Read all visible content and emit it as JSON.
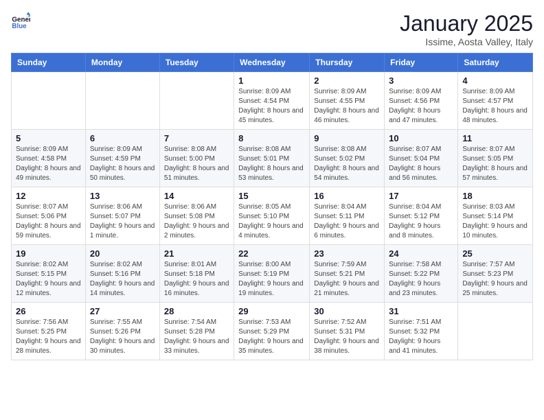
{
  "logo": {
    "line1": "General",
    "line2": "Blue"
  },
  "header": {
    "month": "January 2025",
    "location": "Issime, Aosta Valley, Italy"
  },
  "weekdays": [
    "Sunday",
    "Monday",
    "Tuesday",
    "Wednesday",
    "Thursday",
    "Friday",
    "Saturday"
  ],
  "weeks": [
    [
      {
        "day": "",
        "info": ""
      },
      {
        "day": "",
        "info": ""
      },
      {
        "day": "",
        "info": ""
      },
      {
        "day": "1",
        "info": "Sunrise: 8:09 AM\nSunset: 4:54 PM\nDaylight: 8 hours\nand 45 minutes."
      },
      {
        "day": "2",
        "info": "Sunrise: 8:09 AM\nSunset: 4:55 PM\nDaylight: 8 hours\nand 46 minutes."
      },
      {
        "day": "3",
        "info": "Sunrise: 8:09 AM\nSunset: 4:56 PM\nDaylight: 8 hours\nand 47 minutes."
      },
      {
        "day": "4",
        "info": "Sunrise: 8:09 AM\nSunset: 4:57 PM\nDaylight: 8 hours\nand 48 minutes."
      }
    ],
    [
      {
        "day": "5",
        "info": "Sunrise: 8:09 AM\nSunset: 4:58 PM\nDaylight: 8 hours\nand 49 minutes."
      },
      {
        "day": "6",
        "info": "Sunrise: 8:09 AM\nSunset: 4:59 PM\nDaylight: 8 hours\nand 50 minutes."
      },
      {
        "day": "7",
        "info": "Sunrise: 8:08 AM\nSunset: 5:00 PM\nDaylight: 8 hours\nand 51 minutes."
      },
      {
        "day": "8",
        "info": "Sunrise: 8:08 AM\nSunset: 5:01 PM\nDaylight: 8 hours\nand 53 minutes."
      },
      {
        "day": "9",
        "info": "Sunrise: 8:08 AM\nSunset: 5:02 PM\nDaylight: 8 hours\nand 54 minutes."
      },
      {
        "day": "10",
        "info": "Sunrise: 8:07 AM\nSunset: 5:04 PM\nDaylight: 8 hours\nand 56 minutes."
      },
      {
        "day": "11",
        "info": "Sunrise: 8:07 AM\nSunset: 5:05 PM\nDaylight: 8 hours\nand 57 minutes."
      }
    ],
    [
      {
        "day": "12",
        "info": "Sunrise: 8:07 AM\nSunset: 5:06 PM\nDaylight: 8 hours\nand 59 minutes."
      },
      {
        "day": "13",
        "info": "Sunrise: 8:06 AM\nSunset: 5:07 PM\nDaylight: 9 hours\nand 1 minute."
      },
      {
        "day": "14",
        "info": "Sunrise: 8:06 AM\nSunset: 5:08 PM\nDaylight: 9 hours\nand 2 minutes."
      },
      {
        "day": "15",
        "info": "Sunrise: 8:05 AM\nSunset: 5:10 PM\nDaylight: 9 hours\nand 4 minutes."
      },
      {
        "day": "16",
        "info": "Sunrise: 8:04 AM\nSunset: 5:11 PM\nDaylight: 9 hours\nand 6 minutes."
      },
      {
        "day": "17",
        "info": "Sunrise: 8:04 AM\nSunset: 5:12 PM\nDaylight: 9 hours\nand 8 minutes."
      },
      {
        "day": "18",
        "info": "Sunrise: 8:03 AM\nSunset: 5:14 PM\nDaylight: 9 hours\nand 10 minutes."
      }
    ],
    [
      {
        "day": "19",
        "info": "Sunrise: 8:02 AM\nSunset: 5:15 PM\nDaylight: 9 hours\nand 12 minutes."
      },
      {
        "day": "20",
        "info": "Sunrise: 8:02 AM\nSunset: 5:16 PM\nDaylight: 9 hours\nand 14 minutes."
      },
      {
        "day": "21",
        "info": "Sunrise: 8:01 AM\nSunset: 5:18 PM\nDaylight: 9 hours\nand 16 minutes."
      },
      {
        "day": "22",
        "info": "Sunrise: 8:00 AM\nSunset: 5:19 PM\nDaylight: 9 hours\nand 19 minutes."
      },
      {
        "day": "23",
        "info": "Sunrise: 7:59 AM\nSunset: 5:21 PM\nDaylight: 9 hours\nand 21 minutes."
      },
      {
        "day": "24",
        "info": "Sunrise: 7:58 AM\nSunset: 5:22 PM\nDaylight: 9 hours\nand 23 minutes."
      },
      {
        "day": "25",
        "info": "Sunrise: 7:57 AM\nSunset: 5:23 PM\nDaylight: 9 hours\nand 25 minutes."
      }
    ],
    [
      {
        "day": "26",
        "info": "Sunrise: 7:56 AM\nSunset: 5:25 PM\nDaylight: 9 hours\nand 28 minutes."
      },
      {
        "day": "27",
        "info": "Sunrise: 7:55 AM\nSunset: 5:26 PM\nDaylight: 9 hours\nand 30 minutes."
      },
      {
        "day": "28",
        "info": "Sunrise: 7:54 AM\nSunset: 5:28 PM\nDaylight: 9 hours\nand 33 minutes."
      },
      {
        "day": "29",
        "info": "Sunrise: 7:53 AM\nSunset: 5:29 PM\nDaylight: 9 hours\nand 35 minutes."
      },
      {
        "day": "30",
        "info": "Sunrise: 7:52 AM\nSunset: 5:31 PM\nDaylight: 9 hours\nand 38 minutes."
      },
      {
        "day": "31",
        "info": "Sunrise: 7:51 AM\nSunset: 5:32 PM\nDaylight: 9 hours\nand 41 minutes."
      },
      {
        "day": "",
        "info": ""
      }
    ]
  ]
}
